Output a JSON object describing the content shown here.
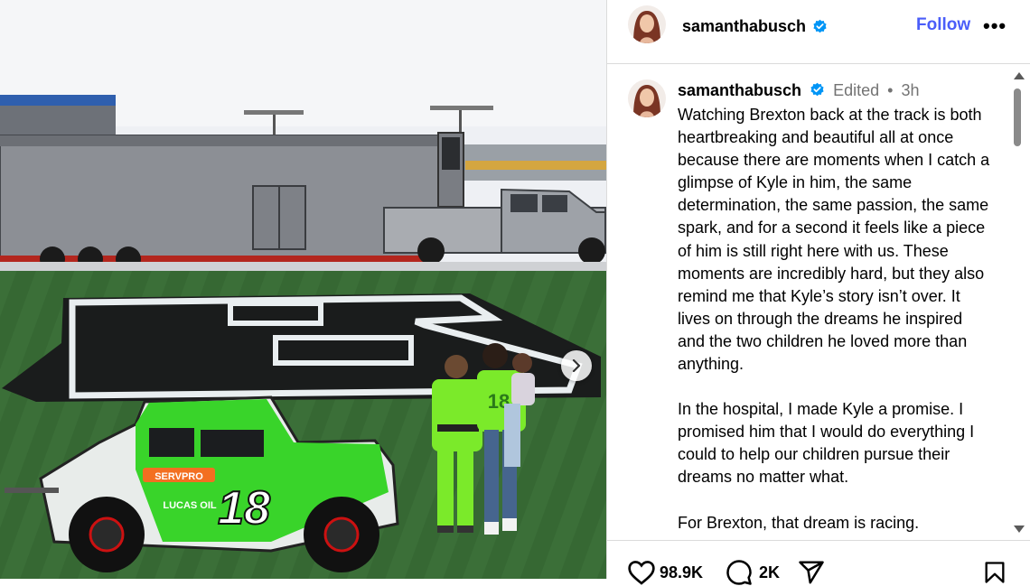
{
  "post": {
    "media": {
      "car_number": "18",
      "car_sponsor": "SERVPRO",
      "car_sponsor_2": "LUCAS OIL",
      "shirt_number": "18"
    },
    "header": {
      "username": "samanthabusch",
      "follow_label": "Follow",
      "more_label": "•••"
    },
    "caption": {
      "username": "samanthabusch",
      "edited": "Edited",
      "separator": "•",
      "time": "3h",
      "paragraphs": [
        "Watching Brexton back at the track is both heartbreaking and beautiful all at once because there are moments when I catch a glimpse of Kyle in him, the same determination, the same passion, the same spark, and for a second it feels like a piece of him is still right here with us. These moments are incredibly hard, but they also remind me that Kyle’s story isn’t over. It lives on through the dreams he inspired and the two children he loved more than anything.",
        "In the hospital, I made Kyle a promise. I promised him that I would do everything I could to help our children pursue their dreams no matter what.",
        "For Brexton, that dream is racing."
      ]
    },
    "actions": {
      "likes": "98.9K",
      "comments": "2K"
    },
    "colors": {
      "verified": "#0095f6",
      "follow": "#4a5df9",
      "car_green": "#39d42a"
    }
  }
}
